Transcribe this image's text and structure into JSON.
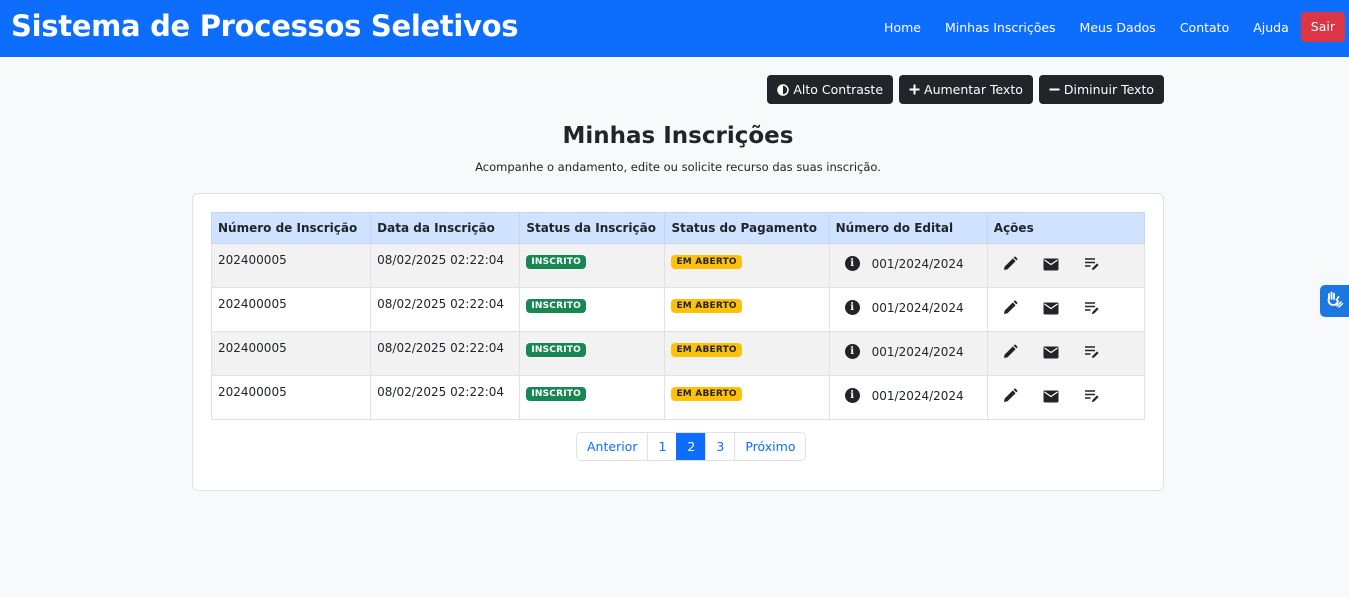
{
  "header": {
    "title": "Sistema de Processos Seletivos",
    "nav": [
      "Home",
      "Minhas Inscrições",
      "Meus Dados",
      "Contato",
      "Ajuda"
    ],
    "logout": "Sair"
  },
  "accessibility": {
    "contrast": "Alto Contraste",
    "increase": "Aumentar Texto",
    "decrease": "Diminuir Texto"
  },
  "page": {
    "title": "Minhas Inscrições",
    "subtitle": "Acompanhe o andamento, edite ou solicite recurso das suas inscrição."
  },
  "table": {
    "columns": [
      "Número de Inscrição",
      "Data da Inscrição",
      "Status da Inscrição",
      "Status do Pagamento",
      "Número do Edital",
      "Ações"
    ],
    "rows": [
      {
        "numero": "202400005",
        "data": "08/02/2025 02:22:04",
        "status": "INSCRITO",
        "pagamento": "EM ABERTO",
        "edital": "001/2024/2024"
      },
      {
        "numero": "202400005",
        "data": "08/02/2025 02:22:04",
        "status": "INSCRITO",
        "pagamento": "EM ABERTO",
        "edital": "001/2024/2024"
      },
      {
        "numero": "202400005",
        "data": "08/02/2025 02:22:04",
        "status": "INSCRITO",
        "pagamento": "EM ABERTO",
        "edital": "001/2024/2024"
      },
      {
        "numero": "202400005",
        "data": "08/02/2025 02:22:04",
        "status": "INSCRITO",
        "pagamento": "EM ABERTO",
        "edital": "001/2024/2024"
      }
    ]
  },
  "pagination": {
    "prev": "Anterior",
    "pages": [
      "1",
      "2",
      "3"
    ],
    "current": "2",
    "next": "Próximo"
  },
  "colors": {
    "primary": "#0d6efd",
    "danger": "#dc3545",
    "success": "#198754",
    "warning": "#ffc107",
    "dark": "#212529",
    "table_header": "#cfe2ff"
  },
  "icons": {
    "contrast": "contrast-icon",
    "increase": "plus-icon",
    "decrease": "minus-icon",
    "info": "info-icon",
    "edit": "pencil-icon",
    "email": "envelope-icon",
    "appeal": "edit-note-icon",
    "vlibras": "sign-language-icon"
  }
}
